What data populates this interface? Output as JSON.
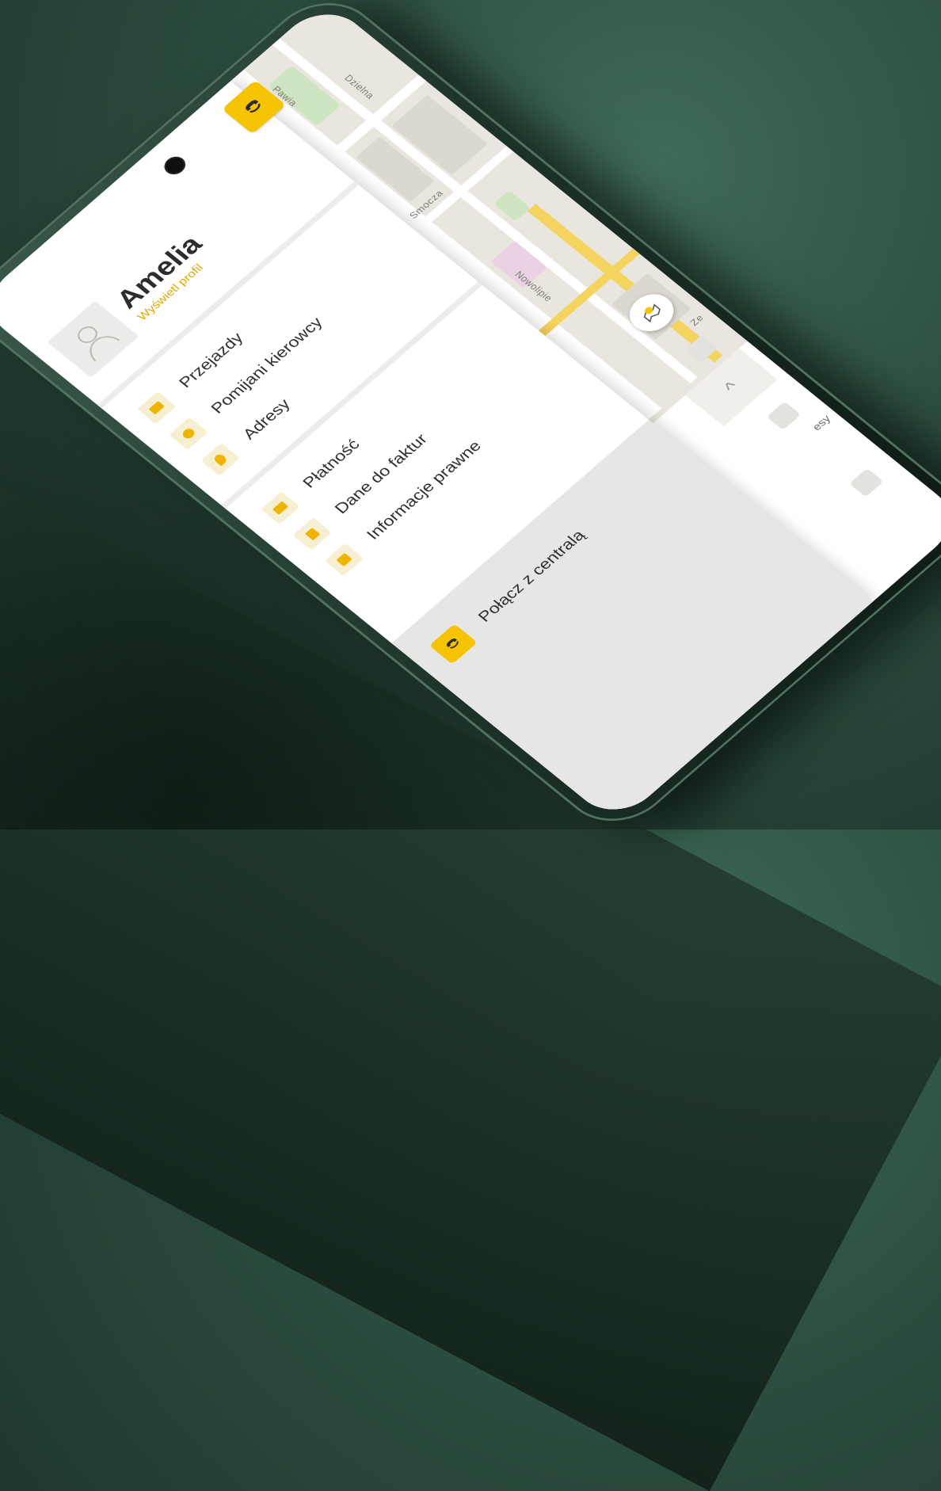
{
  "map": {
    "streets": [
      "Pawia",
      "Dzielna",
      "Smocza",
      "Nowolipie",
      "Ze"
    ],
    "sheet_peek": "esy"
  },
  "profile": {
    "name": "Amelia",
    "link": "Wyświetl profil"
  },
  "menu": {
    "group1": [
      {
        "label": "Przejazdy",
        "icon": "car-icon"
      },
      {
        "label": "Pomijani kierowcy",
        "icon": "driver-block-icon"
      },
      {
        "label": "Adresy",
        "icon": "location-pin-icon"
      }
    ],
    "group2": [
      {
        "label": "Płatność",
        "icon": "wallet-icon"
      },
      {
        "label": "Dane do faktur",
        "icon": "invoice-icon"
      },
      {
        "label": "Informacje prawne",
        "icon": "legal-doc-icon"
      }
    ],
    "call": {
      "label": "Połącz z centralą",
      "icon": "phone-icon"
    }
  },
  "colors": {
    "accent": "#f6c300",
    "accent_text": "#e0a800",
    "drawer_bg": "#ffffff",
    "call_section_bg": "#e6e6e4",
    "background": "#2b4c3e"
  }
}
